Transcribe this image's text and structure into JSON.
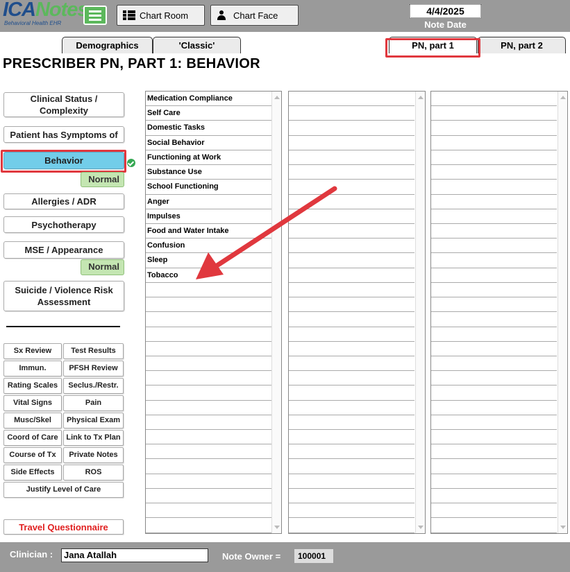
{
  "header": {
    "logo_text_a": "ICA",
    "logo_text_b": "Notes",
    "logo_sub": "Behavioral Health EHR",
    "chart_room_label": "Chart Room",
    "chart_face_label": "Chart Face",
    "date": "4/4/2025",
    "date_label": "Note Date"
  },
  "tabs": {
    "demographics": "Demographics",
    "classic": "'Classic'",
    "pn_part1": "PN, part 1",
    "pn_part2": "PN, part 2"
  },
  "page_title": "PRESCRIBER PN, PART 1:  BEHAVIOR",
  "nav": {
    "clinical_status": "Clinical Status / Complexity",
    "patient_symptoms": "Patient has Symptoms of",
    "behavior": "Behavior",
    "behavior_status": "Normal",
    "allergies": "Allergies / ADR",
    "psychotherapy": "Psychotherapy",
    "mse": "MSE / Appearance",
    "mse_status": "Normal",
    "suicide_risk": "Suicide / Violence Risk Assessment"
  },
  "small_buttons": {
    "sx_review": "Sx Review",
    "test_results": "Test Results",
    "immun": "Immun.",
    "pfsh_review": "PFSH Review",
    "rating_scales": "Rating Scales",
    "seclus": "Seclus./Restr.",
    "vital_signs": "Vital Signs",
    "pain": "Pain",
    "musc": "Musc/Skel",
    "physical_exam": "Physical Exam",
    "coord_care": "Coord of Care",
    "link_tx": "Link to Tx Plan",
    "course_tx": "Course of Tx",
    "private_notes": "Private Notes",
    "side_effects": "Side Effects",
    "ros": "ROS",
    "justify": "Justify Level of Care",
    "travel": "Travel Questionnaire"
  },
  "behavior_list": [
    "Medication Compliance",
    "Self Care",
    "Domestic Tasks",
    "Social Behavior",
    "Functioning at Work",
    "Substance Use",
    "School Functioning",
    "Anger",
    "Impulses",
    "Food and Water Intake",
    "Confusion",
    "Sleep",
    "Tobacco"
  ],
  "footer": {
    "clinician_label": "Clinician :",
    "clinician_name": "Jana Atallah",
    "owner_label": "Note Owner =",
    "owner_value": "100001"
  },
  "colors": {
    "header_bg": "#9a9a9a",
    "selected_nav": "#72cde9",
    "normal_badge": "#c4e6b2",
    "highlight": "#e0383e",
    "logo_blue": "#1f4e8c",
    "logo_green": "#5cb85c"
  }
}
